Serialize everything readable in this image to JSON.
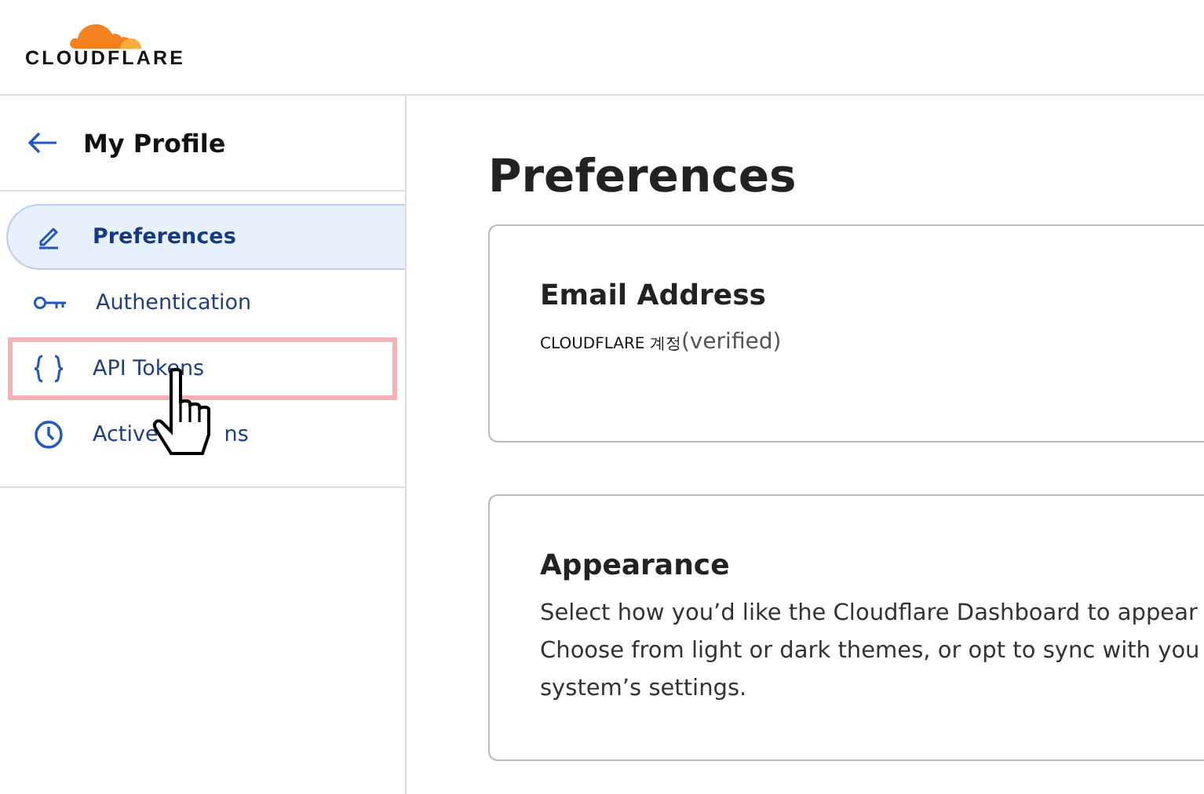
{
  "header": {
    "logo_text": "CLOUDFLARE"
  },
  "sidebar": {
    "back_title": "My Profile",
    "items": [
      {
        "label": "Preferences",
        "selected": true,
        "highlighted": false
      },
      {
        "label": "Authentication",
        "selected": false,
        "highlighted": false
      },
      {
        "label": "API Tokens",
        "selected": false,
        "highlighted": true
      },
      {
        "label": "Active",
        "label_tail": "ns",
        "selected": false,
        "highlighted": false,
        "cursor": true
      }
    ]
  },
  "main": {
    "title": "Preferences",
    "cards": [
      {
        "title": "Email Address",
        "kind": "email",
        "account": "CLOUDFLARE 계정",
        "status": "(verified)"
      },
      {
        "title": "Appearance",
        "kind": "text",
        "lines": [
          "Select how you’d like the Cloudflare Dashboard to appear",
          "Choose from light or dark themes, or opt to sync with you",
          "system’s settings."
        ]
      }
    ]
  }
}
